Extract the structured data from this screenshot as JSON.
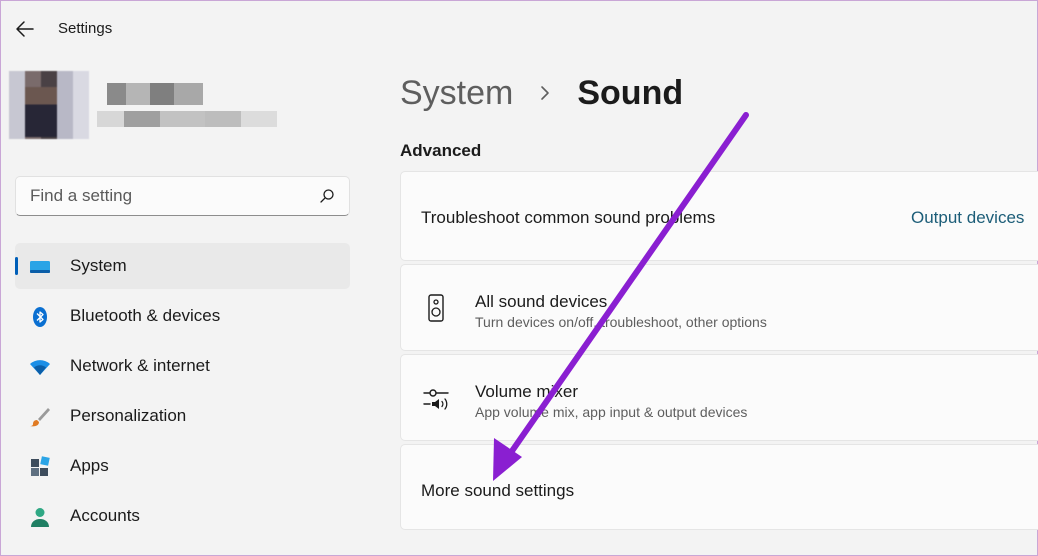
{
  "window": {
    "title": "Settings"
  },
  "search": {
    "placeholder": "Find a setting"
  },
  "sidebar": {
    "items": [
      {
        "label": "System",
        "icon": "system-icon",
        "active": true
      },
      {
        "label": "Bluetooth & devices",
        "icon": "bluetooth-icon"
      },
      {
        "label": "Network & internet",
        "icon": "wifi-icon"
      },
      {
        "label": "Personalization",
        "icon": "brush-icon"
      },
      {
        "label": "Apps",
        "icon": "apps-icon"
      },
      {
        "label": "Accounts",
        "icon": "account-icon"
      }
    ]
  },
  "breadcrumb": {
    "parent": "System",
    "current": "Sound"
  },
  "section": {
    "label": "Advanced"
  },
  "cards": {
    "troubleshoot": {
      "label": "Troubleshoot common sound problems",
      "link": "Output devices"
    },
    "all_devices": {
      "title": "All sound devices",
      "subtitle": "Turn devices on/off, troubleshoot, other options",
      "icon": "speaker-icon"
    },
    "volume_mixer": {
      "title": "Volume mixer",
      "subtitle": "App volume mix, app input & output devices",
      "icon": "mixer-icon"
    },
    "more_settings": {
      "label": "More sound settings"
    }
  },
  "colors": {
    "accent": "#005fb8",
    "link": "#1c5d78",
    "annotation": "#8a1fd1"
  }
}
